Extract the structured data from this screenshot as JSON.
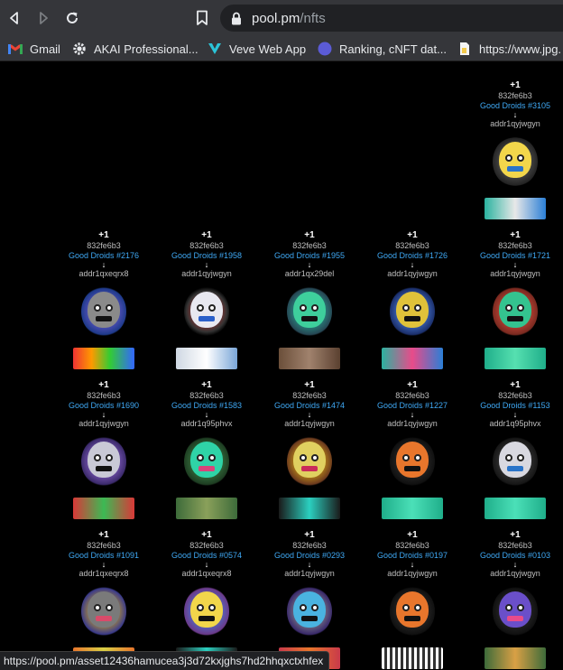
{
  "browser": {
    "url_host": "pool.pm",
    "url_path": "/nfts",
    "bookmarks": [
      {
        "label": "Gmail",
        "icon": "gmail-icon"
      },
      {
        "label": "AKAI Professional...",
        "icon": "gear-icon"
      },
      {
        "label": "Veve Web App",
        "icon": "veve-icon"
      },
      {
        "label": "Ranking, cNFT dat...",
        "icon": "circle-icon"
      },
      {
        "label": "https://www.jpg.",
        "icon": "document-icon"
      }
    ],
    "status_url": "https://pool.pm/asset12436hamucea3j3d72kxjghs7hd2hhqxctxhfex"
  },
  "nfts": [
    {
      "plus": "+1",
      "policy": "832fe6b3",
      "name": "Good Droids #3105",
      "arrow": "↓",
      "addr": "addr1qyjwgyn"
    },
    {
      "plus": "+1",
      "policy": "832fe6b3",
      "name": "Good Droids #2176",
      "arrow": "↓",
      "addr": "addr1qxeqrx8"
    },
    {
      "plus": "+1",
      "policy": "832fe6b3",
      "name": "Good Droids #1958",
      "arrow": "↓",
      "addr": "addr1qyjwgyn"
    },
    {
      "plus": "+1",
      "policy": "832fe6b3",
      "name": "Good Droids #1955",
      "arrow": "↓",
      "addr": "addr1qx29del"
    },
    {
      "plus": "+1",
      "policy": "832fe6b3",
      "name": "Good Droids #1726",
      "arrow": "↓",
      "addr": "addr1qyjwgyn"
    },
    {
      "plus": "+1",
      "policy": "832fe6b3",
      "name": "Good Droids #1721",
      "arrow": "↓",
      "addr": "addr1qyjwgyn"
    },
    {
      "plus": "+1",
      "policy": "832fe6b3",
      "name": "Good Droids #1690",
      "arrow": "↓",
      "addr": "addr1qyjwgyn"
    },
    {
      "plus": "+1",
      "policy": "832fe6b3",
      "name": "Good Droids #1583",
      "arrow": "↓",
      "addr": "addr1q95phvx"
    },
    {
      "plus": "+1",
      "policy": "832fe6b3",
      "name": "Good Droids #1474",
      "arrow": "↓",
      "addr": "addr1qyjwgyn"
    },
    {
      "plus": "+1",
      "policy": "832fe6b3",
      "name": "Good Droids #1227",
      "arrow": "↓",
      "addr": "addr1qyjwgyn"
    },
    {
      "plus": "+1",
      "policy": "832fe6b3",
      "name": "Good Droids #1153",
      "arrow": "↓",
      "addr": "addr1q95phvx"
    },
    {
      "plus": "+1",
      "policy": "832fe6b3",
      "name": "Good Droids #1091",
      "arrow": "↓",
      "addr": "addr1qxeqrx8"
    },
    {
      "plus": "+1",
      "policy": "832fe6b3",
      "name": "Good Droids #0574",
      "arrow": "↓",
      "addr": "addr1qxeqrx8"
    },
    {
      "plus": "+1",
      "policy": "832fe6b3",
      "name": "Good Droids #0293",
      "arrow": "↓",
      "addr": "addr1qyjwgyn"
    },
    {
      "plus": "+1",
      "policy": "832fe6b3",
      "name": "Good Droids #0197",
      "arrow": "↓",
      "addr": "addr1qyjwgyn"
    },
    {
      "plus": "+1",
      "policy": "832fe6b3",
      "name": "Good Droids #0103",
      "arrow": "↓",
      "addr": "addr1qyjwgyn"
    }
  ],
  "colors": {
    "asset_link": "#3fa9f5",
    "toolbar": "#35363a",
    "page_bg": "#000000"
  }
}
